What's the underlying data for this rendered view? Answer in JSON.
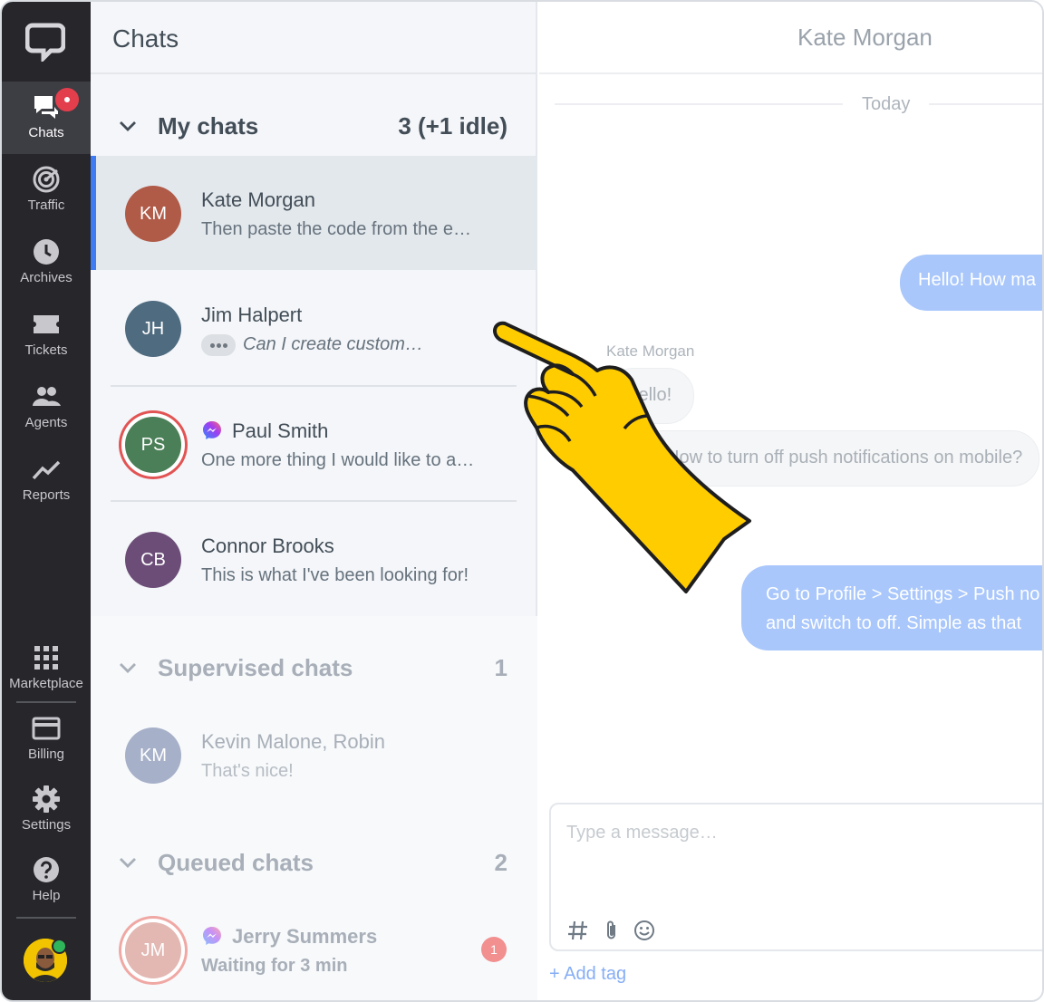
{
  "nav": {
    "items": [
      {
        "label": "Chats",
        "icon": "chat-icon",
        "active": true
      },
      {
        "label": "Traffic",
        "icon": "traffic-icon"
      },
      {
        "label": "Archives",
        "icon": "clock-icon"
      },
      {
        "label": "Tickets",
        "icon": "ticket-icon"
      },
      {
        "label": "Agents",
        "icon": "agents-icon"
      },
      {
        "label": "Reports",
        "icon": "reports-icon"
      }
    ],
    "bottom_items": [
      {
        "label": "Marketplace",
        "icon": "grid-icon"
      },
      {
        "label": "Billing",
        "icon": "card-icon"
      },
      {
        "label": "Settings",
        "icon": "gear-icon"
      },
      {
        "label": "Help",
        "icon": "help-icon"
      }
    ]
  },
  "list": {
    "title": "Chats",
    "my_chats": {
      "title": "My chats",
      "count": "3 (+1 idle)",
      "items": [
        {
          "initials": "KM",
          "name": "Kate Morgan",
          "message": "Then paste the code from the e…",
          "color": "#b05a48",
          "selected": true
        },
        {
          "initials": "JH",
          "name": "Jim Halpert",
          "message": "Can I create custom…",
          "color": "#4f6b80",
          "typing": true
        },
        {
          "initials": "PS",
          "name": "Paul Smith",
          "message": "One more thing I would like to a…",
          "color": "#4a7f57",
          "messenger": true
        },
        {
          "initials": "CB",
          "name": "Connor Brooks",
          "message": "This is what I've been looking for!",
          "color": "#6c4d78"
        }
      ]
    },
    "supervised": {
      "title": "Supervised chats",
      "count": "1",
      "items": [
        {
          "initials": "KM",
          "name": "Kevin Malone, Robin",
          "message": "That's nice!",
          "color": "#a6b0c8"
        }
      ]
    },
    "queued": {
      "title": "Queued chats",
      "count": "2",
      "items": [
        {
          "initials": "JM",
          "name": "Jerry Summers",
          "message": "Waiting for 3 min",
          "color": "#e3b8b3",
          "unread": "1"
        }
      ]
    }
  },
  "conversation": {
    "title": "Kate Morgan",
    "day": "Today",
    "messages": [
      {
        "direction": "out",
        "text": "Hello! How ma"
      },
      {
        "direction": "in",
        "sender": "Kate Morgan",
        "text": "Hello!"
      },
      {
        "direction": "in",
        "text": "How to turn off push notifications on mobile?"
      },
      {
        "direction": "out",
        "text": "Go to Profile > Settings > Push no",
        "text2": "and switch to off. Simple as that"
      }
    ],
    "composer_placeholder": "Type a message…",
    "add_tag": "+ Add tag"
  },
  "colors": {
    "accent": "#3f7cf3",
    "nav_bg": "#26262b",
    "badge": "#e23e4b",
    "hand": "#ffcc00"
  }
}
